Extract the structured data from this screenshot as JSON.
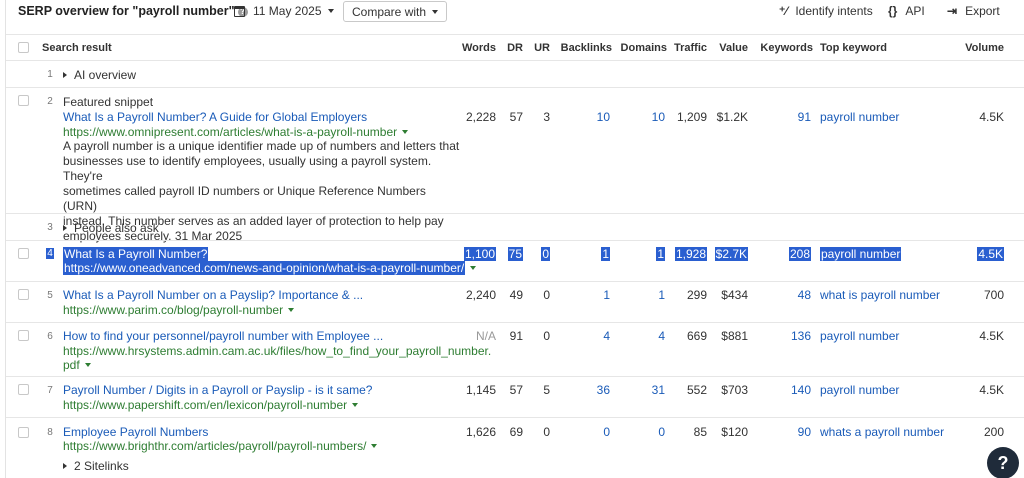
{
  "toolbar": {
    "title": "SERP overview for \"payroll number\"",
    "date": "11 May 2025",
    "compare_label": "Compare with",
    "identify_intents": "Identify intents",
    "api": "API",
    "export": "Export"
  },
  "columns": {
    "search_result": "Search result",
    "words": "Words",
    "dr": "DR",
    "ur": "UR",
    "backlinks": "Backlinks",
    "domains": "Domains",
    "traffic": "Traffic",
    "value": "Value",
    "keywords": "Keywords",
    "top_keyword": "Top keyword",
    "volume": "Volume"
  },
  "rows": [
    {
      "pos": "1",
      "label": "AI overview"
    },
    {
      "pos": "2",
      "type_label": "Featured snippet",
      "title": "What Is a Payroll Number? A Guide for Global Employers",
      "url": "https://www.omnipresent.com/articles/what-is-a-payroll-number",
      "snippet_lines": [
        "A payroll number is a unique identifier made up of numbers and letters that",
        "businesses use to identify employees, usually using a payroll system. They're",
        "sometimes called payroll ID numbers or Unique Reference Numbers (URN)",
        "instead. This number serves as an added layer of protection to help pay",
        "employees securely. 31 Mar 2025"
      ],
      "words": "2,228",
      "dr": "57",
      "ur": "3",
      "backlinks": "10",
      "domains": "10",
      "traffic": "1,209",
      "value": "$1.2K",
      "keywords": "91",
      "top_keyword": "payroll number",
      "volume": "4.5K"
    },
    {
      "pos": "3",
      "label": "People also ask"
    },
    {
      "pos": "4",
      "title": "What Is a Payroll Number?",
      "url": "https://www.oneadvanced.com/news-and-opinion/what-is-a-payroll-number/",
      "words": "1,100",
      "dr": "75",
      "ur": "0",
      "backlinks": "1",
      "domains": "1",
      "traffic": "1,928",
      "value": "$2.7K",
      "keywords": "208",
      "top_keyword": "payroll number",
      "volume": "4.5K"
    },
    {
      "pos": "5",
      "title": "What Is a Payroll Number on a Payslip? Importance & ...",
      "url": "https://www.parim.co/blog/payroll-number",
      "words": "2,240",
      "dr": "49",
      "ur": "0",
      "backlinks": "1",
      "domains": "1",
      "traffic": "299",
      "value": "$434",
      "keywords": "48",
      "top_keyword": "what is payroll number",
      "volume": "700"
    },
    {
      "pos": "6",
      "title": "How to find your personnel/payroll number with Employee ...",
      "url_line1": "https://www.hrsystems.admin.cam.ac.uk/files/how_to_find_your_payroll_number.",
      "url_line2": "pdf",
      "words": "N/A",
      "dr": "91",
      "ur": "0",
      "backlinks": "4",
      "domains": "4",
      "traffic": "669",
      "value": "$881",
      "keywords": "136",
      "top_keyword": "payroll number",
      "volume": "4.5K"
    },
    {
      "pos": "7",
      "title": "Payroll Number / Digits in a Payroll or Payslip - is it same?",
      "url": "https://www.papershift.com/en/lexicon/payroll-number",
      "words": "1,145",
      "dr": "57",
      "ur": "5",
      "backlinks": "36",
      "domains": "31",
      "traffic": "552",
      "value": "$703",
      "keywords": "140",
      "top_keyword": "payroll number",
      "volume": "4.5K"
    },
    {
      "pos": "8",
      "title": "Employee Payroll Numbers",
      "url": "https://www.brighthr.com/articles/payroll/payroll-numbers/",
      "sitelinks": "2 Sitelinks",
      "words": "1,626",
      "dr": "69",
      "ur": "0",
      "backlinks": "0",
      "domains": "0",
      "traffic": "85",
      "value": "$120",
      "keywords": "90",
      "top_keyword": "whats a payroll number",
      "volume": "200"
    }
  ],
  "help_fab": "?"
}
